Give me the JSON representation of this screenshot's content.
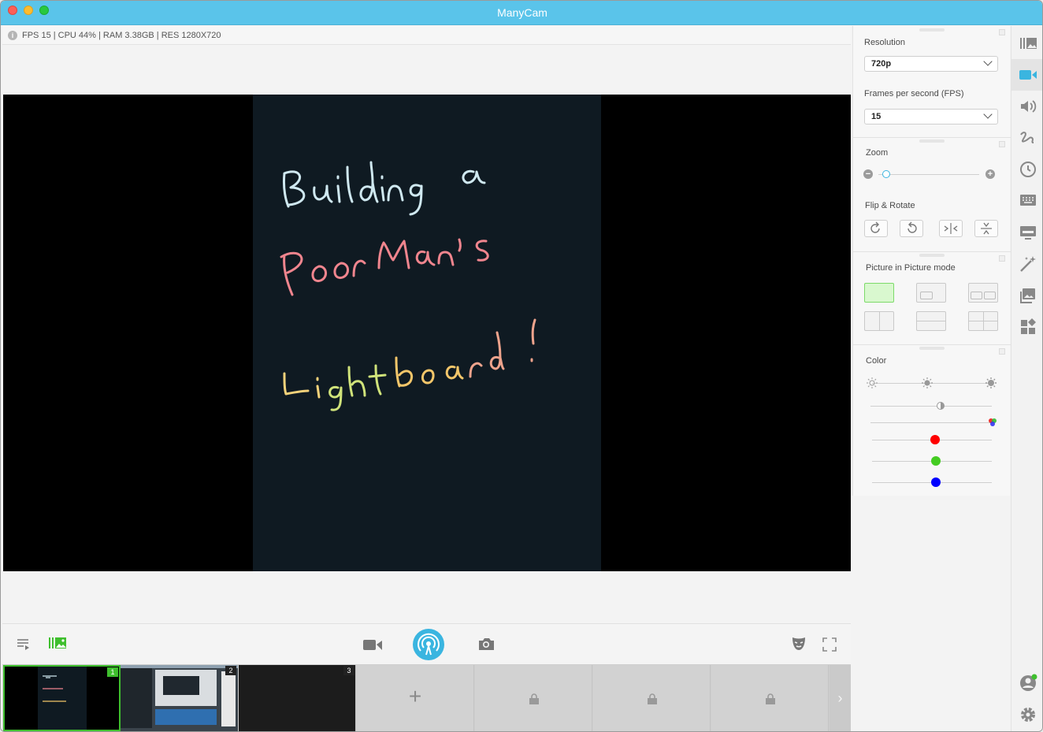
{
  "window": {
    "title": "ManyCam"
  },
  "stats": {
    "info_icon": "i",
    "text": "FPS 15 | CPU 44% | RAM 3.38GB | RES 1280X720"
  },
  "settings": {
    "resolution": {
      "label": "Resolution",
      "value": "720p"
    },
    "fps": {
      "label": "Frames per second (FPS)",
      "value": "15"
    },
    "zoom": {
      "label": "Zoom",
      "minus": "−",
      "plus": "+",
      "level": 0.08
    },
    "flip_rotate": {
      "label": "Flip & Rotate"
    },
    "pip": {
      "label": "Picture in Picture mode"
    },
    "color": {
      "label": "Color",
      "rgb_colors": [
        "#ff0000",
        "#44cc22",
        "#0000ff"
      ]
    }
  },
  "thumbnails": [
    {
      "number": "1",
      "active": true
    },
    {
      "number": "2",
      "active": false
    },
    {
      "number": "3",
      "active": false
    }
  ],
  "thumbnail_controls": {
    "add_label": "+",
    "next": "›"
  },
  "preview": {
    "board_text_lines": [
      "Building  a",
      "Poor Man's",
      "Lightboard !"
    ]
  },
  "icons": {
    "toolbar": [
      "playlist-icon",
      "presets-icon",
      "camera-icon",
      "broadcast-icon",
      "snapshot-icon",
      "mask-icon",
      "fullscreen-icon"
    ],
    "rail": [
      "presets-icon",
      "video-icon",
      "audio-icon",
      "draw-icon",
      "history-icon",
      "lower-third-icon",
      "screen-icon",
      "effects-icon",
      "images-icon",
      "widgets-icon",
      "account-icon",
      "settings-icon"
    ]
  },
  "colors": {
    "accent": "#3ab5e0",
    "titlebar": "#5ac4ea",
    "active_green": "#3fbf2e"
  }
}
